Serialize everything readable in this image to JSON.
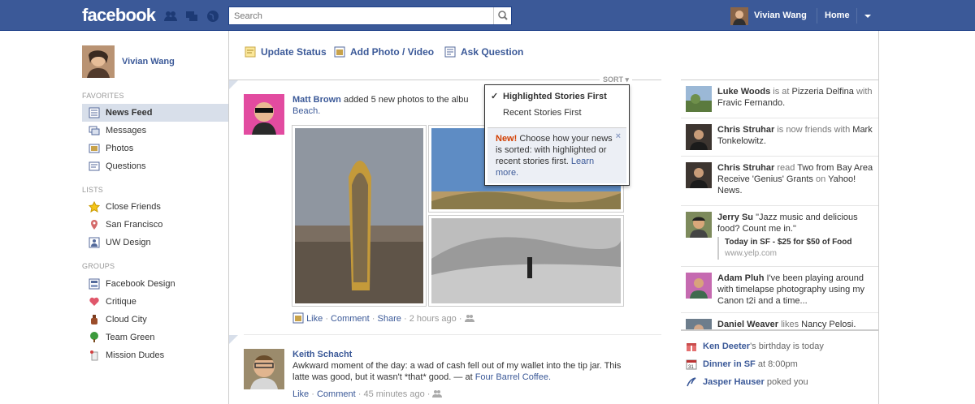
{
  "header": {
    "logo": "facebook",
    "search_placeholder": "Search",
    "user_name": "Vivian Wang",
    "home_label": "Home",
    "jewels": [
      "friend-requests-icon",
      "messages-icon",
      "notifications-icon"
    ]
  },
  "left_nav": {
    "profile_name": "Vivian Wang",
    "favorites_heading": "FAVORITES",
    "favorites": [
      {
        "label": "News Feed",
        "icon": "news-feed-icon",
        "selected": true
      },
      {
        "label": "Messages",
        "icon": "messages-icon"
      },
      {
        "label": "Photos",
        "icon": "photos-icon"
      },
      {
        "label": "Questions",
        "icon": "questions-icon"
      }
    ],
    "lists_heading": "LISTS",
    "lists": [
      {
        "label": "Close Friends",
        "icon": "star-icon"
      },
      {
        "label": "San Francisco",
        "icon": "location-pin-icon"
      },
      {
        "label": "UW Design",
        "icon": "person-icon"
      }
    ],
    "groups_heading": "GROUPS",
    "groups": [
      {
        "label": "Facebook Design",
        "icon": "group-icon"
      },
      {
        "label": "Critique",
        "icon": "heart-icon"
      },
      {
        "label": "Cloud City",
        "icon": "bottle-icon"
      },
      {
        "label": "Team Green",
        "icon": "tree-icon"
      },
      {
        "label": "Mission Dudes",
        "icon": "mission-icon"
      }
    ]
  },
  "composer": {
    "update_status": "Update Status",
    "add_photo": "Add Photo / Video",
    "ask_question": "Ask Question"
  },
  "sort": {
    "label": "SORT",
    "options": [
      "Highlighted Stories First",
      "Recent Stories First"
    ],
    "selected_index": 0,
    "note_new": "New!",
    "note_text": " Choose how your news is sorted: with highlighted or recent stories first.",
    "note_link": "Learn more.",
    "close_label": "×"
  },
  "stories": [
    {
      "author": "Matt Brown",
      "text": " added 5 new photos to the albu",
      "text_line2": "Beach.",
      "actions": {
        "like": "Like",
        "comment": "Comment",
        "share": "Share",
        "time": "2 hours ago",
        "sep": "·"
      }
    },
    {
      "author": "Keith Schacht",
      "text": "Awkward moment of the day: a wad of cash fell out of my wallet into the tip jar. This latte was good, but it wasn't *that* good. — at ",
      "place": "Four Barrel Coffee.",
      "actions": {
        "like": "Like",
        "comment": "Comment",
        "time": "45 minutes ago",
        "sep": "·"
      }
    }
  ],
  "ticker": [
    {
      "name": "Luke Woods",
      "mid": " is at ",
      "obj": "Pizzeria Delfina",
      "tail": " with ",
      "obj2": "Fravic Fernando."
    },
    {
      "name": "Chris Struhar",
      "mid": " is now friends with ",
      "obj": "Mark Tonkelowitz."
    },
    {
      "name": "Chris Struhar",
      "mid": " read ",
      "obj": "Two from Bay Area Receive 'Genius' Grants",
      "tail": " on ",
      "obj2": "Yahoo! News."
    },
    {
      "name": "Jerry Su",
      "mid": " \"Jazz music and delicious food? Count me in.\"",
      "attachment_title": "Today in SF - $25 for $50 of Food",
      "attachment_url": "www.yelp.com"
    },
    {
      "name": "Adam Pluh",
      "mid": " I've been playing around with timelapse photography using my Canon t2i and a time..."
    },
    {
      "name": "Daniel Weaver",
      "mid": " likes ",
      "obj": "Nancy Pelosi."
    }
  ],
  "events": [
    {
      "name": "Ken Deeter",
      "text": "'s birthday is today",
      "icon": "gift-icon"
    },
    {
      "name": "Dinner in SF",
      "text": " at 8:00pm",
      "icon": "calendar-icon"
    },
    {
      "name": "Jasper Hauser",
      "text": " poked you",
      "icon": "poke-icon"
    }
  ]
}
